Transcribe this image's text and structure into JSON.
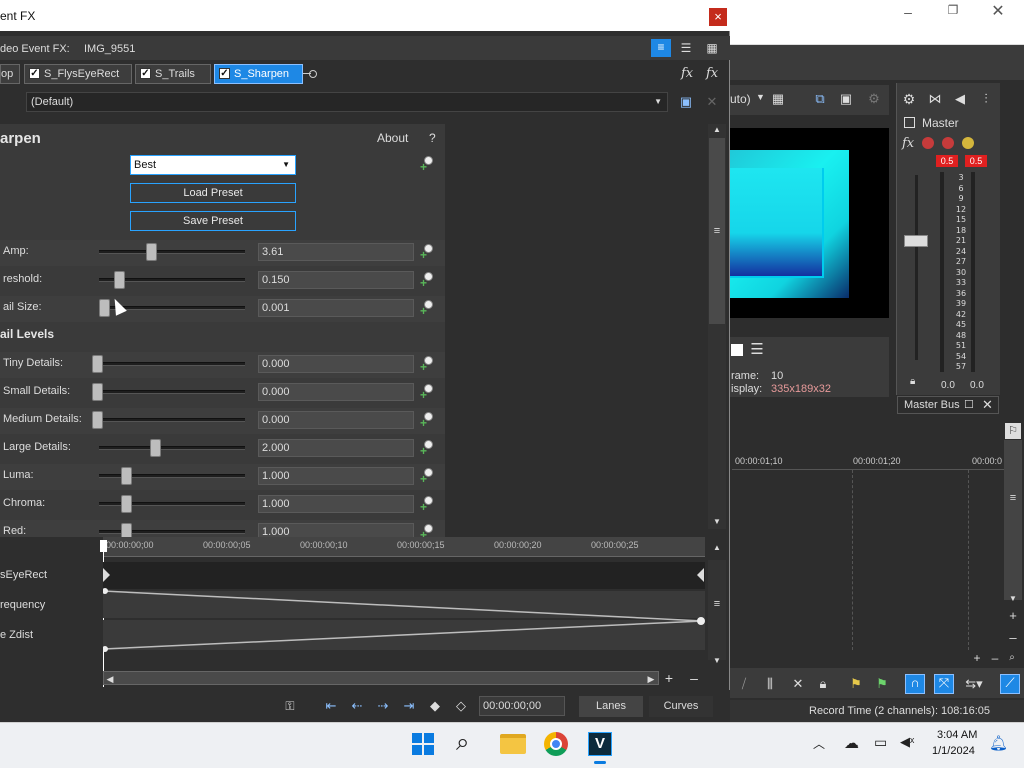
{
  "window": {
    "title": "ent FX",
    "close": "×"
  },
  "fx_header": {
    "title": "deo Event FX:",
    "clip": "IMG_9551"
  },
  "chain": {
    "tabs": [
      {
        "label": "op",
        "checked": false
      },
      {
        "label": "S_FlysEyeRect",
        "checked": true
      },
      {
        "label": "S_Trails",
        "checked": true
      },
      {
        "label": "S_Sharpen",
        "checked": true
      }
    ]
  },
  "preset": {
    "value": "(Default)"
  },
  "plugin": {
    "name": "arpen",
    "about": "About",
    "help": "?"
  },
  "quality": {
    "value": "Best"
  },
  "buttons": {
    "load_preset": "Load Preset",
    "save_preset": "Save Preset"
  },
  "params": [
    {
      "label": "Amp:",
      "value": "3.61",
      "level": 0.37
    },
    {
      "label": "reshold:",
      "value": "0.150",
      "level": 0.15
    },
    {
      "label": "ail Size:",
      "value": "0.001",
      "level": 0.05
    }
  ],
  "detail_section": {
    "title": "ail Levels"
  },
  "detail_params": [
    {
      "label": "Tiny Details:",
      "value": "0.000",
      "level": 0.0
    },
    {
      "label": "Small Details:",
      "value": "0.000",
      "level": 0.0
    },
    {
      "label": "Medium Details:",
      "value": "0.000",
      "level": 0.0
    },
    {
      "label": "Large Details:",
      "value": "2.000",
      "level": 0.4
    },
    {
      "label": "Luma:",
      "value": "1.000",
      "level": 0.2
    },
    {
      "label": "Chroma:",
      "value": "1.000",
      "level": 0.2
    },
    {
      "label": "Red:",
      "value": "1.000",
      "level": 0.2
    }
  ],
  "timeline": {
    "ticks": [
      "00:00:00;00",
      "00:00:00;05",
      "00:00:00;10",
      "00:00:00;15",
      "00:00:00;20",
      "00:00:00;25"
    ],
    "tracks": [
      "sEyeRect",
      "requency",
      "e Zdist"
    ],
    "time_value": "00:00:00;00",
    "lanes": "Lanes",
    "curves": "Curves"
  },
  "preview": {
    "auto": "uto)",
    "frame_label": "rame:",
    "frame_value": "10",
    "display_label": "isplay:",
    "display_value": "335x189x32"
  },
  "master": {
    "title": "Master",
    "peak_left": "0.5",
    "peak_right": "0.5",
    "scale": [
      "3",
      "6",
      "9",
      "12",
      "15",
      "18",
      "21",
      "24",
      "27",
      "30",
      "33",
      "36",
      "39",
      "42",
      "45",
      "48",
      "51",
      "54",
      "57"
    ],
    "bottom_left": "0.0",
    "bottom_right": "0.0",
    "bus_label": "Master Bus"
  },
  "main_timeline": {
    "ticks": [
      "00:00:01;10",
      "00:00:01;20",
      "00:00:0"
    ]
  },
  "status": {
    "record_time": "Record Time (2 channels): 108:16:05"
  },
  "taskbar": {
    "time": "3:04 AM",
    "date": "1/1/2024"
  },
  "colors": {
    "accent": "#1e88e5",
    "highlight": "#29a3ff",
    "cyan": "#1ee6f0"
  }
}
